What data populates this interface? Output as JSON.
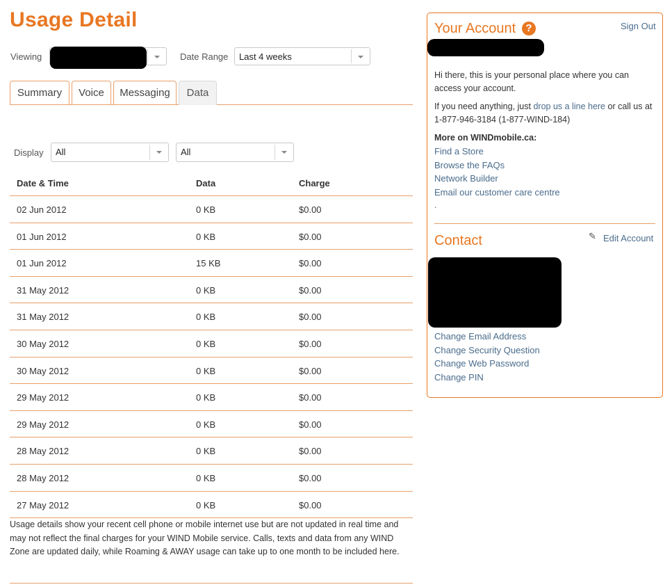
{
  "header": {
    "title": "Usage Detail"
  },
  "filters": {
    "viewing_label": "Viewing",
    "date_range_label": "Date Range",
    "date_range_value": "Last 4 weeks",
    "display_label": "Display",
    "display_value_1": "All",
    "display_value_2": "All"
  },
  "tabs": [
    {
      "label": "Summary"
    },
    {
      "label": "Voice"
    },
    {
      "label": "Messaging"
    },
    {
      "label": "Data"
    }
  ],
  "table": {
    "headers": [
      "Date & Time",
      "Data",
      "Charge"
    ],
    "rows": [
      {
        "date": "02 Jun 2012",
        "data": "0 KB",
        "charge": "$0.00"
      },
      {
        "date": "01 Jun 2012",
        "data": "0 KB",
        "charge": "$0.00"
      },
      {
        "date": "01 Jun 2012",
        "data": "15 KB",
        "charge": "$0.00"
      },
      {
        "date": "31 May 2012",
        "data": "0 KB",
        "charge": "$0.00"
      },
      {
        "date": "31 May 2012",
        "data": "0 KB",
        "charge": "$0.00"
      },
      {
        "date": "30 May 2012",
        "data": "0 KB",
        "charge": "$0.00"
      },
      {
        "date": "30 May 2012",
        "data": "0 KB",
        "charge": "$0.00"
      },
      {
        "date": "29 May 2012",
        "data": "0 KB",
        "charge": "$0.00"
      },
      {
        "date": "29 May 2012",
        "data": "0 KB",
        "charge": "$0.00"
      },
      {
        "date": "28 May 2012",
        "data": "0 KB",
        "charge": "$0.00"
      },
      {
        "date": "28 May 2012",
        "data": "0 KB",
        "charge": "$0.00"
      },
      {
        "date": "27 May 2012",
        "data": "0 KB",
        "charge": "$0.00"
      }
    ]
  },
  "disclaimer": "Usage details show your recent cell phone or mobile internet use but are not updated in real time and may not reflect the final charges for your WIND Mobile service. Calls, texts and data from any WIND Zone are updated daily, while Roaming & AWAY usage can take up to one month to be included here.",
  "account": {
    "heading": "Your Account",
    "help_symbol": "?",
    "sign_out": "Sign Out",
    "intro": "Hi there, this is your personal place where you can access your account.",
    "help_prefix": "If you need anything, just ",
    "help_link": "drop us a line here",
    "help_suffix": " or call us at 1-877-946-3184 (1-877-WIND-184)",
    "more_heading": "More on WINDmobile.ca:",
    "more_links": [
      "Find a Store",
      "Browse the FAQs",
      "Network Builder",
      "Email our customer care centre"
    ],
    "trailing_dot": "."
  },
  "contact": {
    "heading": "Contact",
    "edit_label": "Edit Account",
    "links": [
      "Change Email Address",
      "Change Security Question",
      "Change Web Password",
      "Change PIN"
    ]
  },
  "colors": {
    "accent": "#e87722",
    "link": "#4a6c8c"
  },
  "icons": {
    "help": "question-circle-icon",
    "edit": "pencil-icon",
    "dropdown": "chevron-down-icon"
  }
}
